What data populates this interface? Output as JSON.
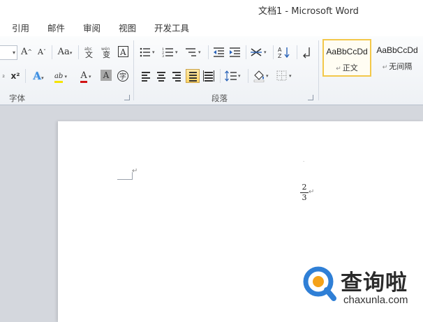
{
  "window": {
    "title": "文档1 - Microsoft Word"
  },
  "tabs": [
    "引用",
    "邮件",
    "审阅",
    "视图",
    "开发工具"
  ],
  "ribbon": {
    "font_group": {
      "label": "字体",
      "grow_font": "A",
      "shrink_font": "A",
      "change_case": "Aa",
      "clear_format": "A",
      "subscript": "₂",
      "superscript": "x²",
      "text_effect": "A",
      "highlight": "ab",
      "font_color": "A",
      "char_shading": "A",
      "enclose_char": "字"
    },
    "paragraph_group": {
      "label": "段落"
    },
    "styles": [
      {
        "sample": "AaBbCcDd",
        "name": "正文"
      },
      {
        "sample": "AaBbCcDd",
        "name": "无间隔"
      }
    ]
  },
  "document": {
    "fraction": {
      "numerator": "2",
      "denominator": "3"
    },
    "paragraph_mark": "↵"
  },
  "watermark": {
    "text": "查询啦",
    "url": "chaxunla.com"
  },
  "colors": {
    "highlight": "#f5e400",
    "font_color": "#d11414",
    "selected_style_border": "#f3c84a",
    "watermark_blue": "#2f7fd6",
    "watermark_orange": "#f4a21a"
  }
}
